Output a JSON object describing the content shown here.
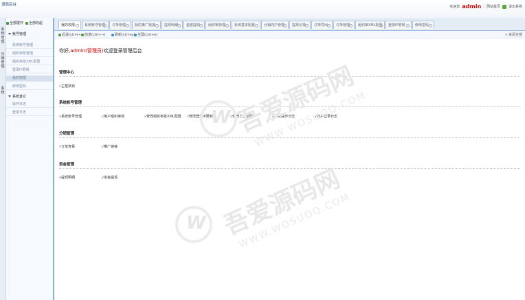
{
  "header": {
    "app_title": "退局后台",
    "welcome": "欢迎您",
    "username": "admin",
    "site_home": "网站首页",
    "logout": "退出系统"
  },
  "left_strip": [
    "系统管理",
    "分销管理",
    "系统"
  ],
  "sidebar": {
    "expand_all": "全部展开",
    "collapse_all": "全部收起",
    "groups": [
      {
        "label": "帐号管理",
        "items": [
          "系统帐号管理",
          "组织审核管理",
          "组织审批XML配置",
          "登录IP限制",
          "我的权限",
          "修改密码"
        ]
      },
      {
        "label": "系统其它",
        "items": [
          "操作日志",
          "登录日志"
        ]
      }
    ],
    "active_item": "我的权限"
  },
  "tabs": [
    "我的权限",
    "系统帐号管理",
    "订单管理",
    "我的推广链接",
    "提现明细",
    "金额提现",
    "组织审管理",
    "系统基本配置",
    "分销商户管理",
    "提现记录",
    "订单导出",
    "订单管理",
    "组织审XML配置",
    "登录IP限制",
    "修改密码"
  ],
  "active_tab": "我的权限",
  "nav": {
    "back": "后退(ctrl+←)",
    "forward": "前进(ctrl+→)",
    "refresh": "刷新(ctrl+q)",
    "fullscreen": "全屏(ctrl+e)",
    "close_all": "关闭全部"
  },
  "content": {
    "greeting_prefix": "你好,",
    "greeting_name": "admin(管理员)",
    "greeting_suffix": "欢迎登录管理后台",
    "sections": [
      {
        "title": "管理中心",
        "links": [
          "√主框架页"
        ]
      },
      {
        "title": "系统帐号管理",
        "links": [
          "√系统帐号管理",
          "√用户组织审核",
          "√修改组织审批XML配置",
          "√修改登录IP限制",
          "√修改自己密码",
          "√系统操作日志",
          "√用户登录日志"
        ]
      },
      {
        "title": "分销管理",
        "links": [
          "√订单查看",
          "√推广链接"
        ]
      },
      {
        "title": "资金管理",
        "links": [
          "√提现明细",
          "√资金提现"
        ]
      }
    ]
  },
  "watermark": {
    "text": "吾爱源码网",
    "url": "WWW.WOSUOQ.COM"
  }
}
